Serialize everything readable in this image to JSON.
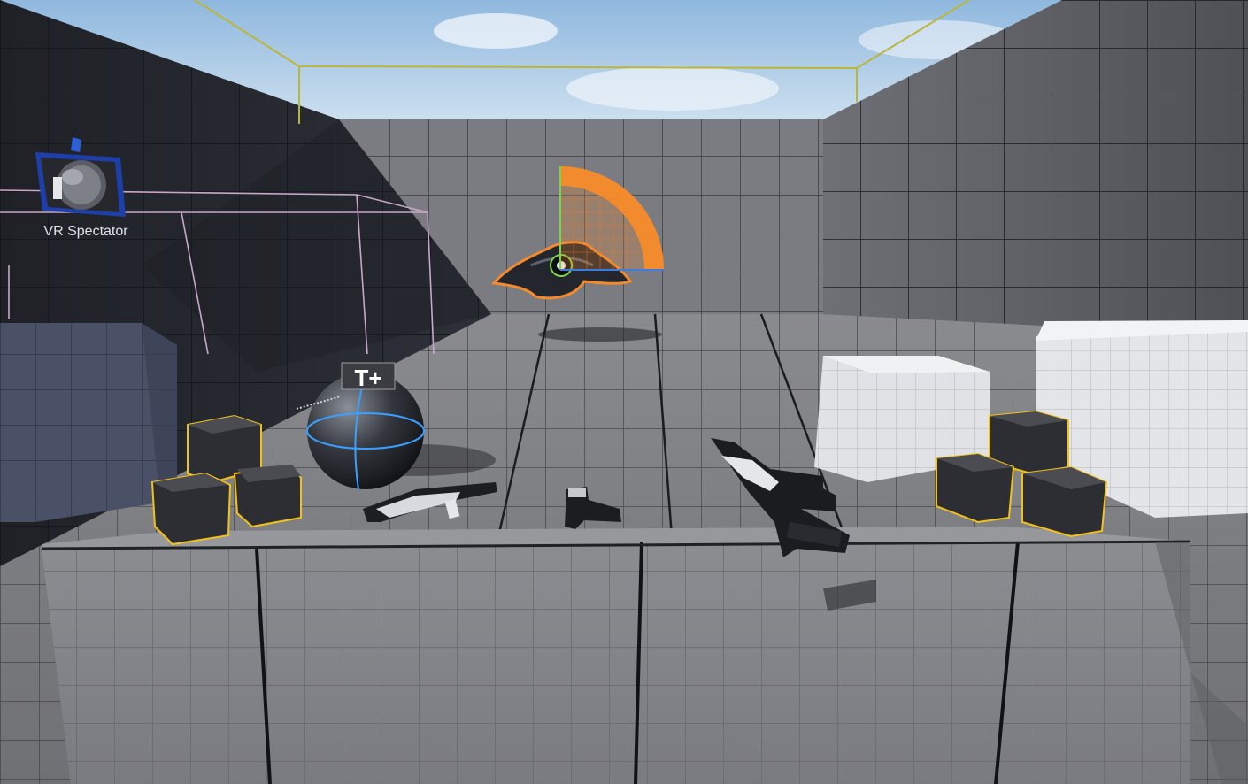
{
  "viewport": {
    "spectator_label": "VR Spectator",
    "text_actor_glyph": "T+"
  },
  "colors": {
    "sky_top": "#8fb8de",
    "sky_bottom": "#d7e6f2",
    "selection_orange": "#f28a2e",
    "selection_yellow": "#f2c21a",
    "gizmo_green": "#7fd34a",
    "gizmo_blue": "#3d7be0",
    "bounds_line": "#b9b63a",
    "volume_pink": "#c9a6c9",
    "sphere_accent": "#3aa0ff"
  },
  "icons": {
    "spectator": "camera-icon",
    "text_actor": "text-render-icon",
    "rotation": "rotate-gizmo-icon"
  }
}
